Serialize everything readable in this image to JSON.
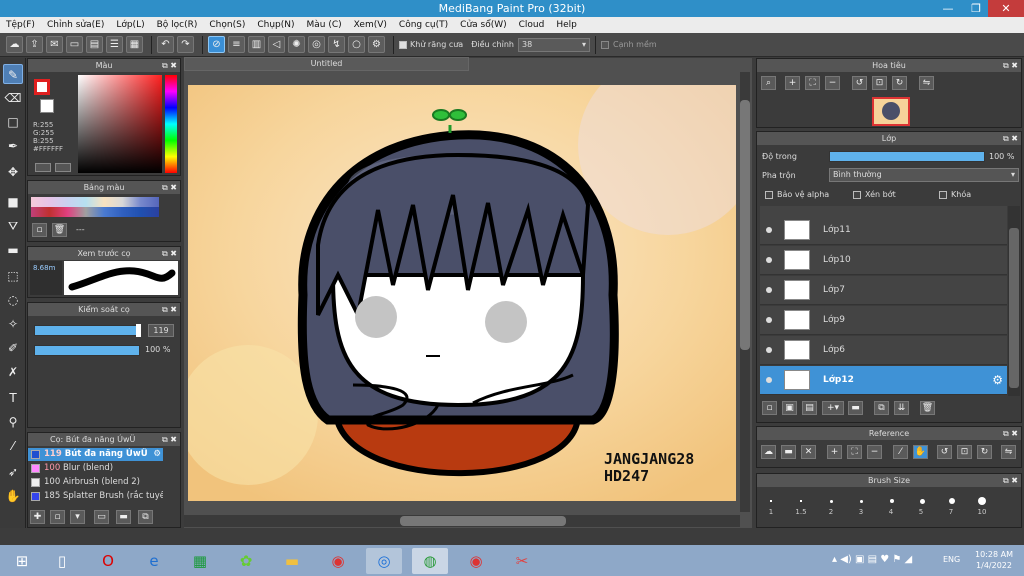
{
  "window": {
    "title": "MediBang Paint Pro (32bit)",
    "minimize": "—",
    "maximize": "❐",
    "close": "✕"
  },
  "menu": [
    "Tệp(F)",
    "Chỉnh sửa(E)",
    "Lớp(L)",
    "Bộ lọc(R)",
    "Chọn(S)",
    "Chụp(N)",
    "Màu (C)",
    "Xem(V)",
    "Công cụ(T)",
    "Cửa sổ(W)",
    "Cloud",
    "Help"
  ],
  "toolbar": {
    "antialias_label": "Khử răng cưa",
    "correction_label": "Điều chỉnh",
    "correction_value": "38",
    "snap_label": "Cạnh mềm"
  },
  "document": {
    "tab_title": "Untitled"
  },
  "color_panel": {
    "title": "Màu",
    "r": "R:255",
    "g": "G:255",
    "b": "B:255",
    "hex": "#FFFFFF"
  },
  "palette_panel": {
    "title": "Bảng màu",
    "empty_label": "---"
  },
  "brush_preview": {
    "title": "Xem trước cọ",
    "size": "8.68m"
  },
  "brush_control": {
    "title": "Kiểm soát cọ",
    "size_value": "119",
    "opacity_value": "100 %"
  },
  "brush_list": {
    "title": "Cọ: Bút đa năng ÚwÜ",
    "items": [
      {
        "size": "119",
        "name": "Bút đa năng ÚwÜ",
        "color": "#1f4fd0"
      },
      {
        "size": "100",
        "name": "Blur (blend)",
        "color": "#ff88ff"
      },
      {
        "size": "100",
        "name": "Airbrush (blend 2)",
        "color": "#eeeeee"
      },
      {
        "size": "185",
        "name": "Splatter Brush (rắc tuyết)",
        "color": "#3344ee"
      }
    ]
  },
  "navigator": {
    "title": "Hoa tiêu"
  },
  "layers_panel": {
    "title": "Lớp",
    "opacity_label": "Độ trong",
    "opacity_value": "100 %",
    "opacity": 1.0,
    "blend_label": "Pha trộn",
    "blend_value": "Bình thường",
    "protect_alpha": "Bảo vệ alpha",
    "clipping": "Xén bớt",
    "lock": "Khóa",
    "layers": [
      {
        "name": "Lớp11"
      },
      {
        "name": "Lớp10"
      },
      {
        "name": "Lớp7"
      },
      {
        "name": "Lớp9"
      },
      {
        "name": "Lớp6"
      },
      {
        "name": "Lớp12"
      }
    ]
  },
  "reference_panel": {
    "title": "Reference"
  },
  "brush_size_panel": {
    "title": "Brush Size",
    "sizes": [
      "1",
      "1.5",
      "2",
      "3",
      "4",
      "5",
      "7",
      "10"
    ]
  },
  "canvas_text": {
    "line1": "JANGJANG28",
    "line2": "HD247"
  },
  "taskbar": {
    "lang": "ENG",
    "time": "10:28 AM",
    "date": "1/4/2022"
  }
}
